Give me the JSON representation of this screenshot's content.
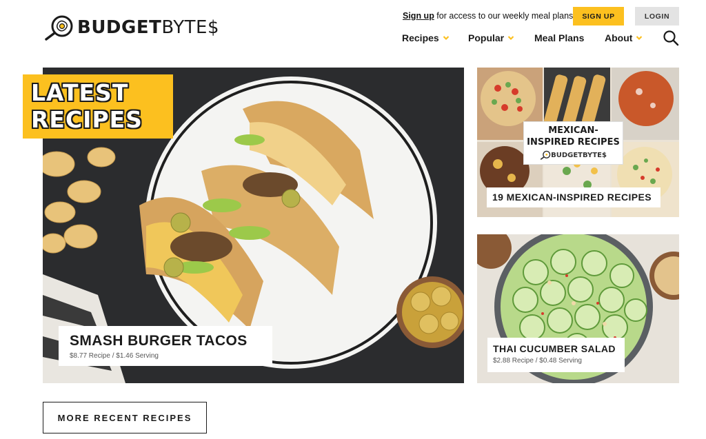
{
  "brand": {
    "name_bold": "BUDGET",
    "name_light": "BYTE$",
    "accent_color": "#fcc01f",
    "logo_icon": "frying-pan-egg-icon"
  },
  "header": {
    "signup_link": "Sign up",
    "signup_text": " for access to our weekly meal plans",
    "signup_button": "SIGN UP",
    "login_button": "LOGIN"
  },
  "nav": {
    "items": [
      {
        "label": "Recipes",
        "has_dropdown": true
      },
      {
        "label": "Popular",
        "has_dropdown": true
      },
      {
        "label": "Meal Plans",
        "has_dropdown": false
      },
      {
        "label": "About",
        "has_dropdown": true
      }
    ],
    "search_icon": "search-icon"
  },
  "hero": {
    "badge_line1": "LATEST",
    "badge_line2": "RECIPES",
    "title": "SMASH BURGER TACOS",
    "meta": "$8.77 Recipe / $1.46 Serving"
  },
  "side_cards": [
    {
      "overlay_line1": "MEXICAN-",
      "overlay_line2": "INSPIRED RECIPES",
      "overlay_brand": "BUDGETBYTE$",
      "title": "19 MEXICAN-INSPIRED RECIPES"
    },
    {
      "title": "THAI CUCUMBER SALAD",
      "meta": "$2.88 Recipe / $0.48 Serving"
    }
  ],
  "more_button": "MORE RECENT RECIPES"
}
